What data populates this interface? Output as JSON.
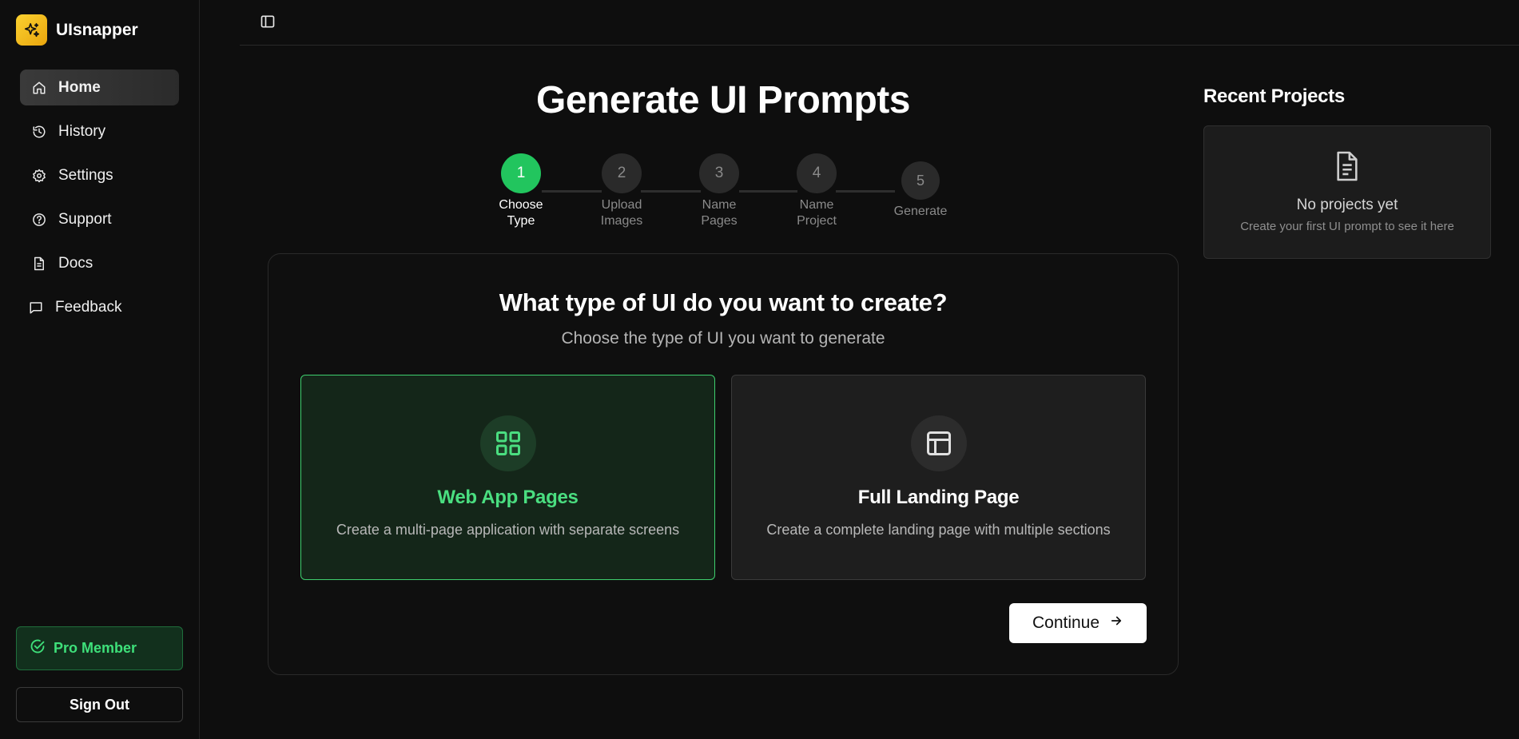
{
  "brand": {
    "name": "UIsnapper",
    "logo_icon": "sparkles-icon",
    "logo_color": "#f4bf1f"
  },
  "sidebar": {
    "items": [
      {
        "label": "Home",
        "icon": "home-icon",
        "active": true
      },
      {
        "label": "History",
        "icon": "history-icon"
      },
      {
        "label": "Settings",
        "icon": "gear-icon"
      },
      {
        "label": "Support",
        "icon": "help-circle-icon"
      },
      {
        "label": "Docs",
        "icon": "document-icon"
      },
      {
        "label": "Feedback",
        "icon": "message-icon"
      }
    ],
    "pro_label": "Pro Member",
    "signout_label": "Sign Out"
  },
  "main": {
    "title": "Generate UI Prompts",
    "steps": [
      {
        "number": "1",
        "label_line1": "Choose",
        "label_line2": "Type",
        "active": true
      },
      {
        "number": "2",
        "label_line1": "Upload",
        "label_line2": "Images"
      },
      {
        "number": "3",
        "label_line1": "Name",
        "label_line2": "Pages"
      },
      {
        "number": "4",
        "label_line1": "Name",
        "label_line2": "Project"
      },
      {
        "number": "5",
        "label_line1": "Generate",
        "label_line2": ""
      }
    ],
    "question": "What type of UI do you want to create?",
    "question_sub": "Choose the type of UI you want to generate",
    "options": [
      {
        "title": "Web App Pages",
        "desc": "Create a multi-page application with separate screens",
        "icon": "grid-icon",
        "selected": true
      },
      {
        "title": "Full Landing Page",
        "desc": "Create a complete landing page with multiple sections",
        "icon": "layout-icon",
        "selected": false
      }
    ],
    "continue_label": "Continue"
  },
  "recent": {
    "title": "Recent Projects",
    "empty_title": "No projects yet",
    "empty_sub": "Create your first UI prompt to see it here"
  },
  "colors": {
    "accent": "#22c55e",
    "accent_text": "#4ade80",
    "background": "#0e0e0e"
  }
}
